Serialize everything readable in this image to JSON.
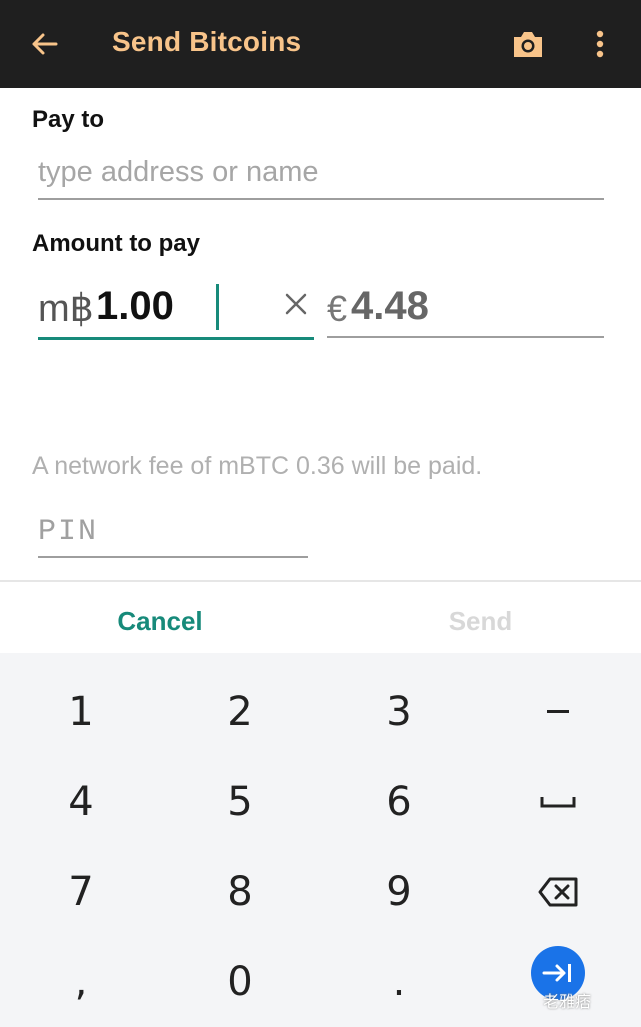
{
  "appbar": {
    "title": "Send Bitcoins"
  },
  "pay_to": {
    "label": "Pay to",
    "placeholder": "type address or name"
  },
  "amount": {
    "label": "Amount to pay",
    "btc_prefix": "m฿",
    "btc_value": "1.00",
    "fiat_prefix": "€",
    "fiat_value": "4.48"
  },
  "fee_text": "A network fee of mBTC 0.36 will be paid.",
  "pin": {
    "placeholder": "PIN"
  },
  "actions": {
    "cancel": "Cancel",
    "send": "Send"
  },
  "keyboard": {
    "keys": [
      "1",
      "2",
      "3",
      "−",
      "4",
      "5",
      "6",
      "␣",
      "7",
      "8",
      "9",
      "⌫",
      ",",
      "0",
      ".",
      "→|"
    ]
  },
  "watermark": "老雅痞",
  "colors": {
    "appbar_bg": "#1f1f1f",
    "appbar_text": "#f8c48a",
    "accent": "#178a7a",
    "enter_key": "#1a73e8"
  }
}
